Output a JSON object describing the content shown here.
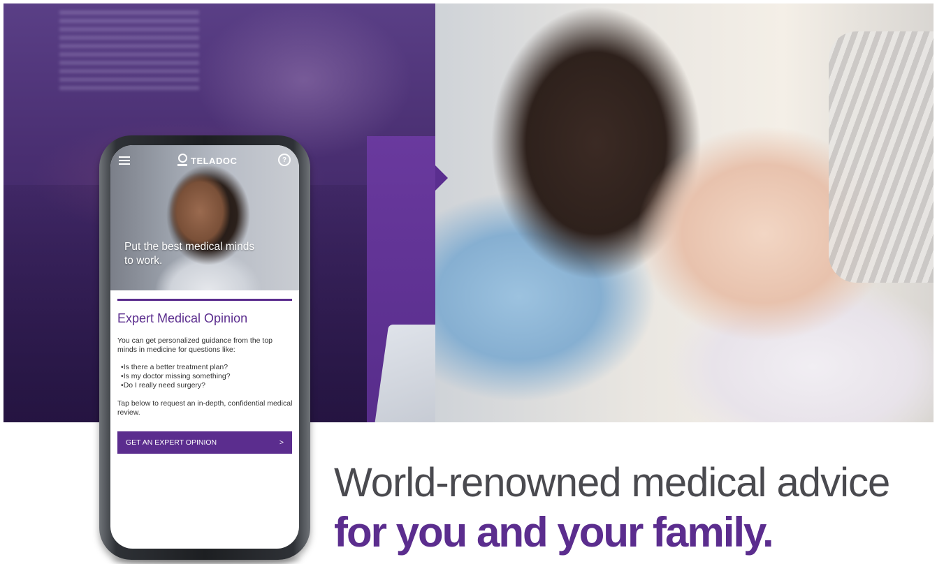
{
  "phone": {
    "brand_name": "TELADOC",
    "help_icon": "?",
    "hero_tagline": "Put the best medical minds to work.",
    "section_title": "Expert Medical Opinion",
    "intro": "You can get personalized guidance from the top minds in medicine for questions like:",
    "questions": [
      "Is there a better treatment plan?",
      "Is my doctor missing something?",
      "Do I really need surgery?"
    ],
    "cta_text": "Tap below to request an in-depth, confidential medical review.",
    "cta_button_label": "GET AN EXPERT OPINION",
    "cta_button_arrow": ">"
  },
  "headline": {
    "line1": "World-renowned medical advice",
    "line2": "for you and your family."
  },
  "colors": {
    "brand_purple": "#5b2d8e",
    "headline_gray": "#4a4a4f"
  },
  "icons": [
    "menu-icon",
    "teladoc-logo-icon",
    "help-icon",
    "chevron-right-icon"
  ]
}
